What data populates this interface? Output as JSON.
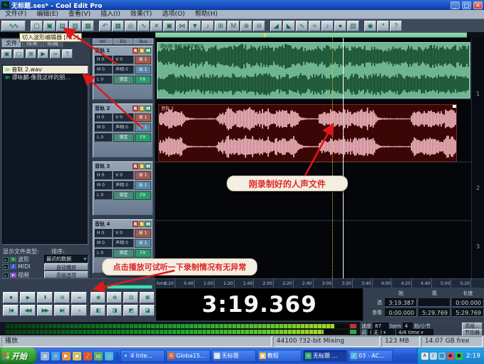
{
  "window": {
    "title": "无标题.ses* - Cool Edit Pro",
    "min": "_",
    "max": "□",
    "close": "×"
  },
  "menu": {
    "items": [
      "文件(F)",
      "编辑(E)",
      "查看(V)",
      "插入(I)",
      "效果(T)",
      "选项(O)",
      "帮助(H)"
    ]
  },
  "toolbar": {
    "g1": [
      {
        "name": "multitrack-view-toggle-button",
        "g": "∿∿"
      }
    ],
    "g2": [
      {
        "name": "new-session-button",
        "g": "▢"
      },
      {
        "name": "open-session-button",
        "g": "▣"
      },
      {
        "name": "save-session-button",
        "g": "▤"
      },
      {
        "name": "import-file-button",
        "g": "▥"
      },
      {
        "name": "file-properties-button",
        "g": "▦"
      }
    ],
    "g3": [
      {
        "name": "undo-button",
        "g": "↶"
      },
      {
        "name": "mixers-window-button",
        "g": "▦"
      },
      {
        "name": "cd-player-view-button",
        "g": "◎"
      },
      {
        "name": "edit-waveform-button",
        "g": "∿"
      },
      {
        "name": "cut-button",
        "g": "✕"
      },
      {
        "name": "copy-button",
        "g": "▣"
      },
      {
        "name": "mix-down-button",
        "g": "⋈"
      },
      {
        "name": "marker-button",
        "g": "▼"
      },
      {
        "name": "metronome-button",
        "g": "♪"
      },
      {
        "name": "group-blocks-button",
        "g": "⊞"
      },
      {
        "name": "mute-block-button",
        "g": "M"
      },
      {
        "name": "zoom-in-horizontal-button",
        "g": "⊕"
      },
      {
        "name": "zoom-out-horizontal-button",
        "g": "⊖"
      }
    ],
    "g4": [
      {
        "name": "volume-envelope-button",
        "g": "◢"
      },
      {
        "name": "pan-envelope-button",
        "g": "◣"
      },
      {
        "name": "wet-dry-envelope-button",
        "g": "∿"
      },
      {
        "name": "fx-envelope-button",
        "g": "≈"
      },
      {
        "name": "tempo-map-button",
        "g": "♪"
      },
      {
        "name": "punch-in-button",
        "g": "●"
      },
      {
        "name": "device-order-button",
        "g": "▧"
      }
    ],
    "g5": [
      {
        "name": "cd-burn-button",
        "g": "◉"
      },
      {
        "name": "settings-button",
        "g": "*"
      },
      {
        "name": "help-button",
        "g": "?"
      }
    ]
  },
  "tooltip": {
    "text": "切入波形编辑器 [F12]"
  },
  "organizer": {
    "tabs": [
      "文件",
      "效果",
      "收藏"
    ],
    "icons": [
      {
        "name": "open-file-button",
        "g": "▣"
      },
      {
        "name": "close-file-button",
        "g": "▢"
      },
      {
        "name": "insert-to-multitrack-button",
        "g": "⊞"
      },
      {
        "name": "play-preview-button",
        "g": "▶"
      },
      {
        "name": "loop-preview-button",
        "g": "∞"
      },
      {
        "name": "organizer-help-button",
        "g": "?"
      }
    ],
    "files": [
      {
        "name": "音轨  2.wav",
        "selected": true
      },
      {
        "name": "谭咏麟-像我这样的朋...",
        "selected": false
      }
    ],
    "filter": {
      "show_label": "显示文件类型:",
      "sort_label": "排序:",
      "sort_value": "最近的数据",
      "type1": "波形",
      "type2": "MIDI",
      "type3": "视频",
      "btn1": "自动播放",
      "btn2": "高级选项"
    }
  },
  "mixer": {
    "tabs": [
      "Vol",
      "EQ",
      "Bus"
    ],
    "tracks": [
      {
        "name": "音轨 1",
        "r": "R",
        "s": "S",
        "m": "M",
        "f1": "H 0",
        "f2": "V 0",
        "b1": "录 1",
        "f3": "M 0",
        "f4": "声相 0",
        "b2": "出 1",
        "f5": "L 0",
        "b3": "锁定",
        "b4": "FX"
      },
      {
        "name": "音轨 2",
        "r": "R",
        "s": "S",
        "m": "M",
        "f1": "H 0",
        "f2": "V 0",
        "b1": "录 1",
        "f3": "M 0",
        "f4": "声相 0",
        "b2": "出 1",
        "f5": "L 0",
        "b3": "锁定",
        "b4": "FX"
      },
      {
        "name": "音轨 3",
        "r": "R",
        "s": "S",
        "m": "M",
        "f1": "H 0",
        "f2": "V 0",
        "b1": "录 1",
        "f3": "M 0",
        "f4": "声相 0",
        "b2": "出 1",
        "f5": "L 0",
        "b3": "锁定",
        "b4": "FX"
      },
      {
        "name": "音轨 4",
        "r": "R",
        "s": "S",
        "m": "M",
        "f1": "H 0",
        "f2": "V 0",
        "b1": "录 1",
        "f3": "M 0",
        "f4": "声相 0",
        "b2": "出 1",
        "f5": "L 0",
        "b3": "锁定",
        "b4": "FX"
      }
    ]
  },
  "clips": {
    "track1_label": "谭咏麟-像我这样的朋友",
    "track2_label": "音轨 2"
  },
  "track_numbers": [
    "1",
    "2",
    "3"
  ],
  "ruler": {
    "unit": "hms",
    "ticks": [
      "0:20",
      "0:40",
      "1:00",
      "1:20",
      "1:40",
      "2:00",
      "2:20",
      "2:40",
      "3:00",
      "3:20",
      "3:40",
      "4:00",
      "4:20",
      "4:40",
      "5:00",
      "5:20"
    ]
  },
  "transport": {
    "row1": [
      {
        "name": "stop-button",
        "g": "■"
      },
      {
        "name": "play-button",
        "g": "▶"
      },
      {
        "name": "pause-button",
        "g": "II"
      },
      {
        "name": "play-looped-button",
        "g": "⊙"
      },
      {
        "name": "loop-button",
        "g": "∞"
      }
    ],
    "row2": [
      {
        "name": "go-to-beginning-button",
        "g": "|◀"
      },
      {
        "name": "rewind-button",
        "g": "◀◀"
      },
      {
        "name": "fast-forward-button",
        "g": "▶▶"
      },
      {
        "name": "go-to-end-button",
        "g": "▶|"
      },
      {
        "name": "record-button",
        "g": "●",
        "rec": true
      }
    ]
  },
  "zoom": {
    "row1": [
      {
        "name": "zoom-in-button",
        "g": "⊕"
      },
      {
        "name": "zoom-out-button",
        "g": "⊖"
      },
      {
        "name": "zoom-full-button",
        "g": "⊡"
      },
      {
        "name": "zoom-to-selection-button",
        "g": "⊠"
      }
    ],
    "row2": [
      {
        "name": "zoom-in-vertical-button",
        "g": "◧"
      },
      {
        "name": "zoom-out-vertical-button",
        "g": "◨"
      },
      {
        "name": "zoom-left-edge-button",
        "g": "◩"
      },
      {
        "name": "zoom-right-edge-button",
        "g": "◪"
      }
    ]
  },
  "time_display": {
    "value": "3:19.369"
  },
  "sel_view": {
    "h1": "始",
    "h2": "尾",
    "h3": "长度",
    "rows": [
      {
        "label": "选",
        "v1": "3:19.387",
        "v2": "",
        "v3": "0:00.000"
      },
      {
        "label": "查看",
        "v1": "0:00.000",
        "v2": "5:29.769",
        "v3": "5:29.769"
      }
    ]
  },
  "tempo": {
    "speed_label": "速度",
    "bpm": "87",
    "bpm_unit": "bpm",
    "beats": "4",
    "beats_unit": "拍/小节",
    "advanced_btn": "高级...",
    "key_label": "调",
    "key_value": "( 无 )",
    "meter_value": "4/4 time",
    "metronome_btn": "节拍器"
  },
  "status": {
    "left": "播放",
    "format": "44100 ?32-bit Mixing",
    "memory": "123 MB",
    "disk": "14.07 GB free"
  },
  "annotations": {
    "vocal": "刚录制好的人声文件",
    "play": "点击播放可试听一下录制情况有无异常"
  },
  "taskbar": {
    "start": "开始",
    "quick_launch": [
      {
        "name": "show-desktop-icon",
        "ic": "#8ab4e8",
        "g": "▦"
      },
      {
        "name": "ie-icon",
        "ic": "#48a0e8",
        "g": "e"
      },
      {
        "name": "media-player-icon",
        "ic": "#f09030",
        "g": "▶"
      },
      {
        "name": "folder-icon",
        "ic": "#e8c850",
        "g": "▣"
      },
      {
        "name": "winamp-icon",
        "ic": "#e05828",
        "g": "♪"
      },
      {
        "name": "acdsee-icon",
        "ic": "#58b858",
        "g": "▤"
      },
      {
        "name": "messenger-icon",
        "ic": "#40b8e8",
        "g": "@"
      }
    ],
    "tasks": [
      {
        "label": "4 Inte...",
        "ic": "#2a6ae0",
        "g": "e",
        "active": false
      },
      {
        "label": "Globa15...",
        "ic": "#e06a20",
        "g": "G",
        "active": false
      },
      {
        "label": "无标题",
        "ic": "#d0d8e0",
        "g": "▤",
        "active": false
      },
      {
        "label": "教程",
        "ic": "#e8c050",
        "g": "▣",
        "active": false
      },
      {
        "label": "无标题 ...",
        "ic": "#38b068",
        "g": "∿",
        "active": true
      },
      {
        "label": "03 - AC...",
        "ic": "#58b8d8",
        "g": "♪",
        "active": false
      }
    ],
    "tray": [
      {
        "name": "ime-tray-icon",
        "ic": "#e8e8e8",
        "g": "A"
      },
      {
        "name": "volume-tray-icon",
        "ic": "#c8d8e8",
        "g": "♪"
      },
      {
        "name": "network-tray-icon",
        "ic": "#78c0e8",
        "g": "▥"
      },
      {
        "name": "antivirus-tray-icon",
        "ic": "#e05050",
        "g": "●"
      },
      {
        "name": "scheduler-tray-icon",
        "ic": "#38c038",
        "g": "■"
      }
    ],
    "clock": "2:19"
  },
  "colors": {
    "clip1_bg": "#6fb591",
    "clip1_wave": "#0f4527",
    "clip2_bg": "#3a0606",
    "clip2_wave": "#ffc2cc",
    "arrow": "#e01818"
  }
}
